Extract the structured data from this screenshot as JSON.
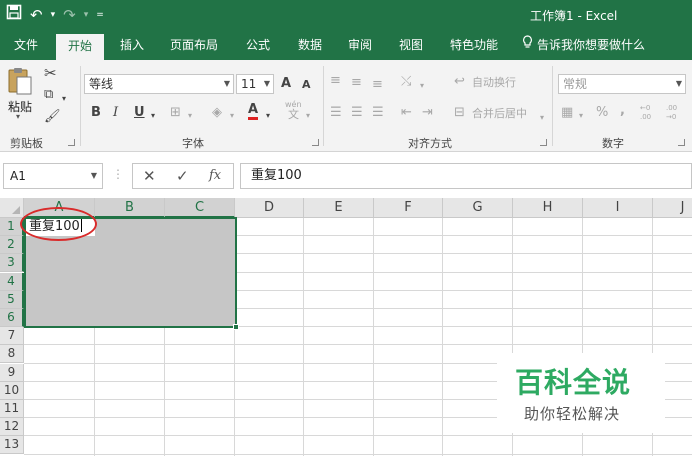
{
  "titlebar": {
    "title": "工作簿1 - Excel",
    "undo_arrow": "▾",
    "redo_arrow": "▾",
    "customize": "="
  },
  "tabs": [
    "文件",
    "开始",
    "插入",
    "页面布局",
    "公式",
    "数据",
    "审阅",
    "视图",
    "特色功能"
  ],
  "active_tab": "开始",
  "tell_me": "告诉我你想要做什么",
  "ribbon": {
    "clipboard": {
      "paste_label": "粘贴",
      "group_label": "剪贴板"
    },
    "font": {
      "font_name": "等线",
      "font_size": "11",
      "grow": "A",
      "shrink": "A",
      "bold": "B",
      "italic": "I",
      "underline": "U",
      "font_color_glyph": "A",
      "phonetic_glyph": "文",
      "phonetic_top": "wén",
      "group_label": "字体"
    },
    "alignment": {
      "wrap_text": "自动换行",
      "merge_center": "合并后居中",
      "group_label": "对齐方式"
    },
    "number": {
      "format": "常规",
      "percent": "%",
      "comma": ",",
      "inc_top": "←0",
      "inc_bottom": ".00",
      "dec_top": ".00",
      "dec_bottom": "→0",
      "group_label": "数字"
    }
  },
  "formula_bar": {
    "name_box": "A1",
    "cancel": "✕",
    "enter": "✓",
    "fx": "fx",
    "content": "重复100"
  },
  "columns": [
    "A",
    "B",
    "C",
    "D",
    "E",
    "F",
    "G",
    "H",
    "I",
    "J"
  ],
  "rows": [
    "1",
    "2",
    "3",
    "4",
    "5",
    "6",
    "7",
    "8",
    "9",
    "10",
    "11",
    "12",
    "13"
  ],
  "cells": {
    "A1": "重复100"
  },
  "watermark": {
    "title": "百科全说",
    "subtitle": "助你轻松解决"
  },
  "colors": {
    "excel_green": "#217346",
    "selection_gray": "#c6c6c6",
    "annotation_red": "#d92b2b",
    "watermark_green": "#2eaa62"
  }
}
